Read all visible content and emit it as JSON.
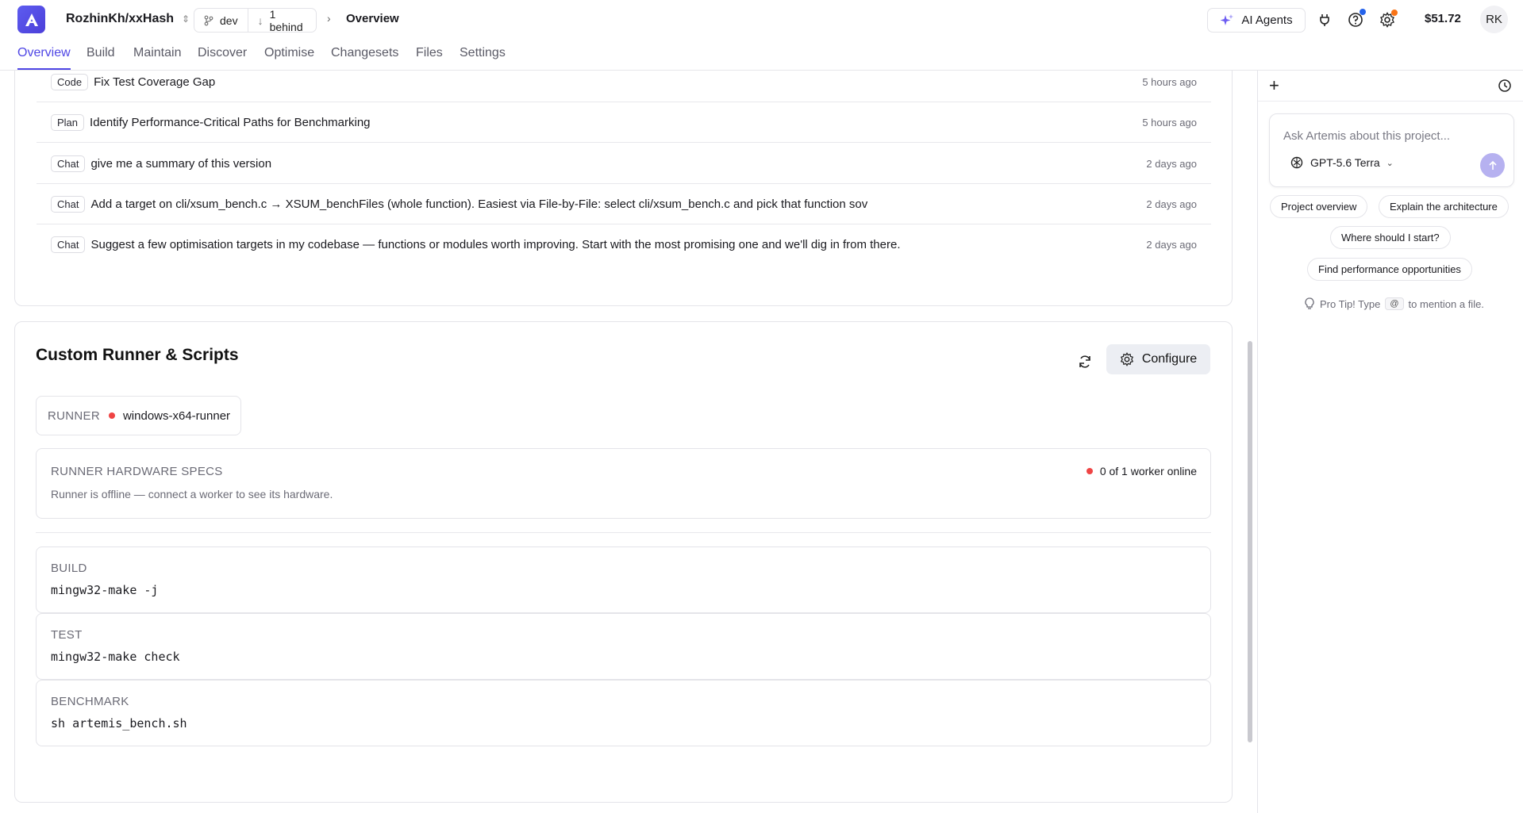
{
  "header": {
    "repo": "RozhinKh/xxHash",
    "branch": "dev",
    "behind": "1 behind",
    "crumb": "Overview",
    "ai_agents": "AI Agents",
    "balance": "$51.72",
    "avatar_initials": "RK"
  },
  "tabs": [
    "Overview",
    "Build",
    "Maintain",
    "Discover",
    "Optimise",
    "Changesets",
    "Files",
    "Settings"
  ],
  "recent": [
    {
      "tag": "Code",
      "text": "Fix Test Coverage Gap",
      "time": "5 hours ago"
    },
    {
      "tag": "Plan",
      "text": "Identify Performance-Critical Paths for Benchmarking",
      "time": "5 hours ago"
    },
    {
      "tag": "Chat",
      "text": "give me a summary of this version",
      "time": "2 days ago"
    },
    {
      "tag": "Chat",
      "text": "Add a target on cli/xsum_bench.c → XSUM_benchFiles (whole function). Easiest via File-by-File: select cli/xsum_bench.c and pick that function sov",
      "time": "2 days ago"
    },
    {
      "tag": "Chat",
      "text": "Suggest a few optimisation targets in my codebase — functions or modules worth improving. Start with the most promising one and we'll dig in from there.",
      "time": "2 days ago"
    }
  ],
  "runner_section": {
    "title": "Custom Runner & Scripts",
    "configure": "Configure",
    "runner_label": "RUNNER",
    "runner_name": "windows-x64-runner",
    "hw_title": "RUNNER HARDWARE SPECS",
    "hw_desc": "Runner is offline — connect a worker to see its hardware.",
    "hw_status": "0 of 1 worker online",
    "commands": [
      {
        "label": "BUILD",
        "value": "mingw32-make -j"
      },
      {
        "label": "TEST",
        "value": "mingw32-make check"
      },
      {
        "label": "BENCHMARK",
        "value": "sh artemis_bench.sh"
      }
    ]
  },
  "panel": {
    "placeholder": "Ask Artemis about this project...",
    "model": "GPT-5.6 Terra",
    "suggestions": [
      "Project overview",
      "Explain the architecture",
      "Where should I start?",
      "Find performance opportunities"
    ],
    "tip_prefix": "Pro Tip! Type",
    "tip_key": "@",
    "tip_suffix": "to mention a file."
  },
  "colors": {
    "accent": "#4f46e5",
    "offline": "#ef4444"
  }
}
